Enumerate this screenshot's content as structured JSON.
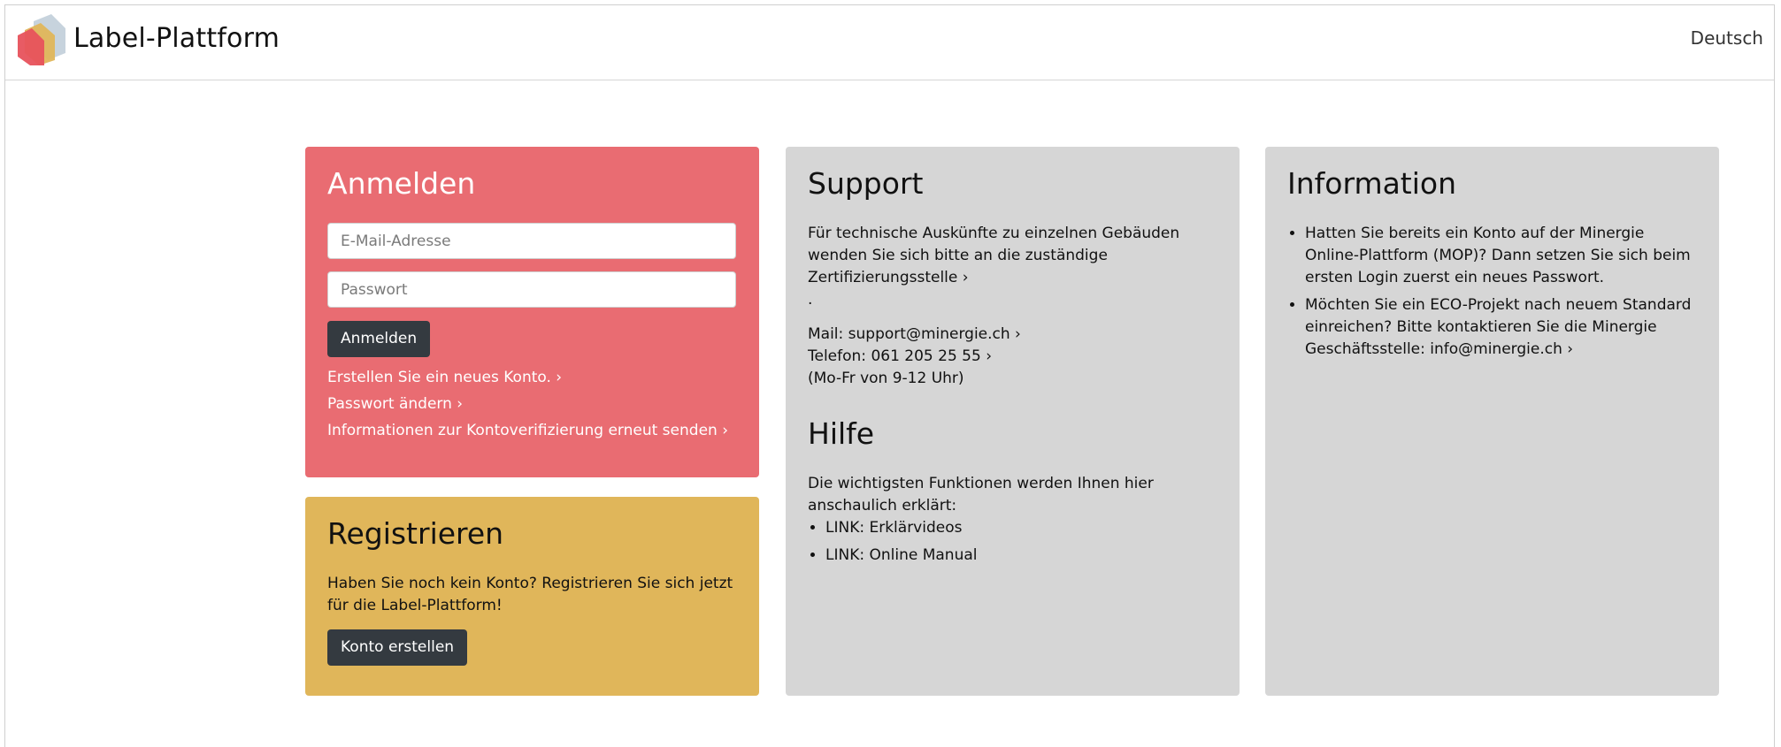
{
  "header": {
    "brand": "Label-Plattform",
    "language": "Deutsch"
  },
  "colors": {
    "login_bg": "#e96c72",
    "register_bg": "#e0b65a",
    "panel_bg": "#d6d6d6",
    "button_bg": "#343a40"
  },
  "login": {
    "title": "Anmelden",
    "email_placeholder": "E-Mail-Adresse",
    "password_placeholder": "Passwort",
    "submit_label": "Anmelden",
    "links": [
      "Erstellen Sie ein neues Konto. ›",
      "Passwort ändern ›",
      "Informationen zur Kontoverifizierung erneut senden ›"
    ]
  },
  "register": {
    "title": "Registrieren",
    "text": "Haben Sie noch kein Konto? Registrieren Sie sich jetzt für die Label-Plattform!",
    "button_label": "Konto erstellen"
  },
  "support": {
    "title": "Support",
    "text_lead": "Für technische Auskünfte zu einzelnen Gebäuden wenden Sie sich bitte an die zuständige ",
    "cert_link": "Zertifizierungsstelle ›",
    "dot": ".",
    "mail_label": "Mail: ",
    "mail_link": "support@minergie.ch ›",
    "phone_label": "Telefon: ",
    "phone_link": "061 205 25 55 ›",
    "hours": "(Mo-Fr von 9-12 Uhr)"
  },
  "help": {
    "title": "Hilfe",
    "text": "Die wichtigsten Funktionen werden Ihnen hier anschaulich erklärt:",
    "items": [
      "LINK: Erklärvideos",
      "LINK: Online Manual"
    ]
  },
  "information": {
    "title": "Information",
    "item1": "Hatten Sie bereits ein Konto auf der Minergie Online-Plattform (MOP)? Dann setzen Sie sich beim ersten Login zuerst ein neues Passwort.",
    "item2_text": "Möchten Sie ein ECO-Projekt nach neuem Standard einreichen? Bitte kontaktieren Sie die Minergie Geschäftsstelle: ",
    "item2_link": "info@minergie.ch ›"
  }
}
